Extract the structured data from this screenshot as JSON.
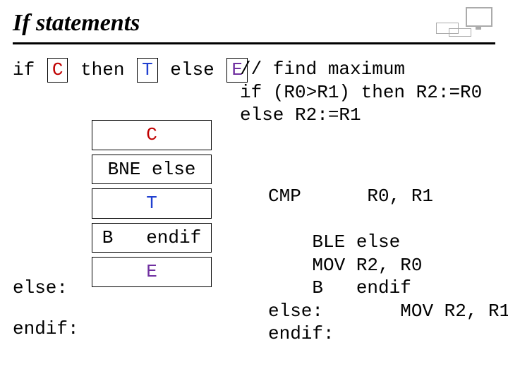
{
  "title": "If statements",
  "schema": {
    "if": "if",
    "C": "C",
    "then": "then",
    "T": "T",
    "else": "else",
    "E": "E"
  },
  "comment": {
    "l1": "// find maximum",
    "l2": "if (R0>R1) then R2:=R0",
    "l3": "else R2:=R1"
  },
  "flow": {
    "box_C": "C",
    "bne": "BNE else",
    "box_T": "T",
    "b_endif": "B   endif",
    "box_E": "E",
    "else_lbl": "else:",
    "endif_lbl": "endif:"
  },
  "asm": {
    "cmp": "CMP      R0, R1",
    "ble": "    BLE else",
    "mov20": "    MOV R2, R0",
    "bendif": "    B   endif",
    "elselbl": "else:",
    "mov21": "       MOV R2, R1",
    "endiflbl": "endif:"
  }
}
